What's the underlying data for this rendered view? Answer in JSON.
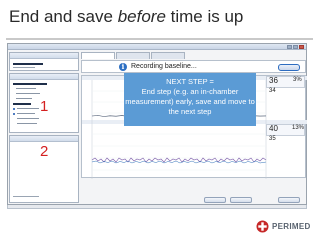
{
  "slide": {
    "title_prefix": "End and save ",
    "title_emphasis": "before",
    "title_suffix": " time is up"
  },
  "status": {
    "text": "Recording baseline...",
    "info_icon": "info-icon"
  },
  "callout": {
    "line1": "NEXT STEP =",
    "line2": "End step (e.g. an in-chamber",
    "line3": "measurement) early, save and move to",
    "line4": "the next step"
  },
  "markers": {
    "one": "1",
    "two": "2"
  },
  "readouts": {
    "top_value": "36",
    "top_small": "3%",
    "top_sub": "34",
    "mid_value": "40",
    "mid_small": "13%",
    "mid_sub": "35"
  },
  "logo": {
    "text": "PERIMED",
    "icon": "perimed-logo-mark"
  },
  "colors": {
    "callout_bg": "#5b9bd5",
    "marker": "#d42020",
    "info_blue": "#2c6fc3"
  }
}
